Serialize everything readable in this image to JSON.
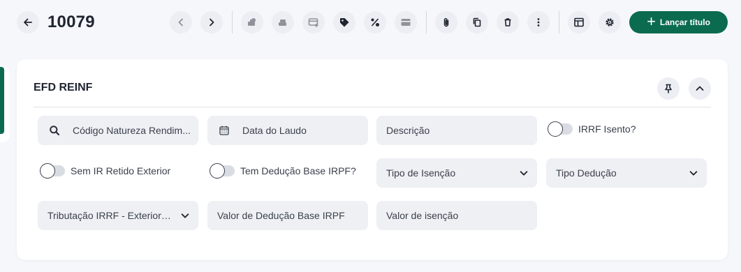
{
  "header": {
    "record_id": "10079",
    "launch_button_label": "Lançar título"
  },
  "card": {
    "title": "EFD REINF"
  },
  "fields": {
    "natureza_rendimento": "Código Natureza Rendim...",
    "data_laudo": "Data do Laudo",
    "descricao": "Descrição",
    "irrf_isento": "IRRF Isento?",
    "sem_ir_retido": "Sem IR Retido Exterior",
    "tem_deducao": "Tem Dedução Base IRPF?",
    "tipo_isencao": "Tipo de Isenção",
    "tipo_deducao": "Tipo Dedução",
    "tributacao_irrf": "Tributação IRRF - Exterior ...",
    "valor_deducao": "Valor de Dedução Base IRPF",
    "valor_isencao": "Valor de isenção"
  },
  "toggles": {
    "irrf_isento": false,
    "sem_ir_retido": false,
    "tem_deducao": false
  },
  "colors": {
    "primary": "#0b6b4f",
    "page_background": "#f6f7fb",
    "field_background": "#eef0f4"
  },
  "icons": [
    "arrow-left-icon",
    "chevron-left-icon",
    "chevron-right-icon",
    "money-stack-icon",
    "money-stack-alt-icon",
    "card-add-icon",
    "tag-icon",
    "percent-icon",
    "credit-card-icon",
    "paperclip-icon",
    "copy-icon",
    "trash-icon",
    "more-vertical-icon",
    "layout-icon",
    "gear-icon",
    "plus-icon",
    "pin-icon",
    "chevron-up-icon",
    "search-icon",
    "calendar-icon",
    "chevron-down-icon"
  ]
}
